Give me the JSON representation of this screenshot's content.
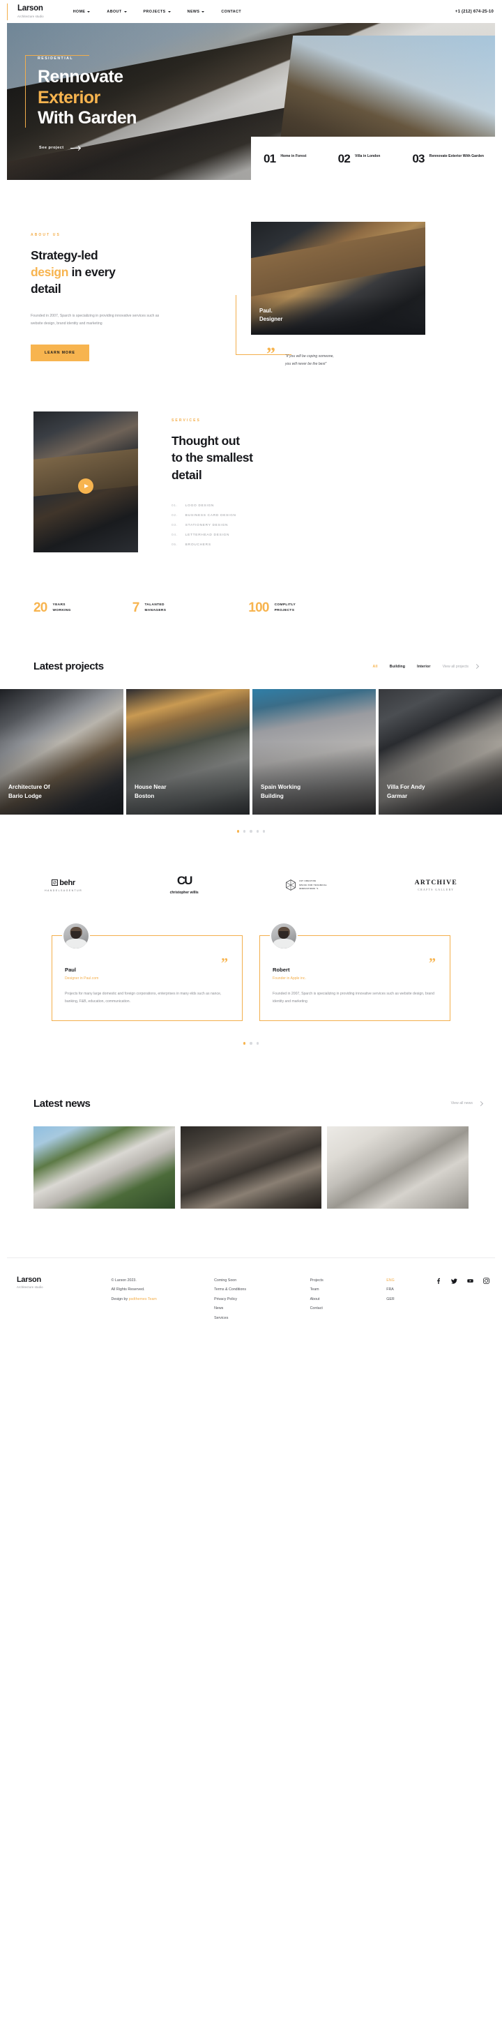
{
  "brand": {
    "name": "Larson",
    "tagline": "Architecture studio"
  },
  "header": {
    "nav": [
      {
        "label": "HOME",
        "has_dropdown": true
      },
      {
        "label": "ABOUT",
        "has_dropdown": true
      },
      {
        "label": "PROJECTS",
        "has_dropdown": true
      },
      {
        "label": "NEWS",
        "has_dropdown": true
      },
      {
        "label": "CONTACT",
        "has_dropdown": false
      }
    ],
    "phone": "+1 (212) 674-25-10"
  },
  "hero": {
    "kicker": "RESIDENTIAL",
    "title_line1": "Rennovate",
    "title_line2": "Exterior",
    "title_line3": "With Garden",
    "cta": "See project",
    "cards": [
      {
        "num": "01",
        "label": "Home in Forest"
      },
      {
        "num": "02",
        "label": "Villa in London"
      },
      {
        "num": "03",
        "label": "Rennovate Exterior With Garden"
      }
    ]
  },
  "about": {
    "kicker": "ABOUT US",
    "title_a": "Strategy-led",
    "title_accent": "design",
    "title_b": " in every",
    "title_c": "detail",
    "body": "Founded in 2007, Sparch is specializing in providing innovative services such as website design, brand identity and marketing",
    "button": "LEARN MORE",
    "image_caption_line1": "Paul.",
    "image_caption_line2": "Designer",
    "quote_line1": "“If you will be coping someone,",
    "quote_line2": "you will never be the best”"
  },
  "services": {
    "kicker": "SERVICES",
    "title_line1": "Thought out",
    "title_line2": "to the smallest",
    "title_line3": "detail",
    "items": [
      {
        "num": "01.",
        "label": "LOGO DESIGN"
      },
      {
        "num": "02.",
        "label": "BUSINESS CARD DESIGN"
      },
      {
        "num": "03.",
        "label": "STATIONERY DESIGN"
      },
      {
        "num": "04.",
        "label": "LETTERHEAD DESIGN"
      },
      {
        "num": "05.",
        "label": "BROUCHERS"
      }
    ]
  },
  "stats": [
    {
      "value": "20",
      "label_line1": "YEARS",
      "label_line2": "WORKING"
    },
    {
      "value": "7",
      "label_line1": "TALANTED",
      "label_line2": "MANAGERS"
    },
    {
      "value": "100",
      "label_line1": "COMPLITLY",
      "label_line2": "PROJECTS"
    }
  ],
  "projects": {
    "title": "Latest projects",
    "filters": [
      {
        "label": "All",
        "active": true
      },
      {
        "label": "Building",
        "active": false
      },
      {
        "label": "Interior",
        "active": false
      }
    ],
    "view_all": "View all projects",
    "cards": [
      {
        "title_line1": "Architecture Of",
        "title_line2": "Bario Lodge"
      },
      {
        "title_line1": "House Near",
        "title_line2": "Boston"
      },
      {
        "title_line1": "Spain Working",
        "title_line2": "Building"
      },
      {
        "title_line1": "Villa For Andy",
        "title_line2": "Garmar"
      }
    ],
    "dots": 5,
    "active_dot": 0
  },
  "partners": [
    {
      "name": "behr",
      "sub": "HANDELSAGENTUR"
    },
    {
      "name": "christopher willis",
      "mark": "CU"
    },
    {
      "name": "1st creative space",
      "lines": [
        "1ST CREATIVE",
        "SPACE FOR TECHNICAL",
        "INNOVATIONS *1"
      ]
    },
    {
      "name": "ARTCHIVE",
      "sub": "CRAFTS GALLERY"
    }
  ],
  "testimonials": {
    "cards": [
      {
        "name": "Paul",
        "role": "Designer in Paul.com",
        "text": "Projects for many large domestic and foreign corporations, enterprises in many elds such as nance, banking, F&B, education, communication."
      },
      {
        "name": "Robert",
        "role": "Founder in Apple inc.",
        "text": "Founded in 2007, Sparch is specializing in providing innovative services such as website design, brand identity and marketing"
      }
    ],
    "dots": 3,
    "active_dot": 0
  },
  "news": {
    "title": "Latest news",
    "view_all": "View all news",
    "cards": [
      {
        "id": 1
      },
      {
        "id": 2
      },
      {
        "id": 3
      }
    ]
  },
  "footer": {
    "copyright_line1": "© Larson 2023.",
    "copyright_line2": "All Rights Reserved.",
    "design_by_prefix": "Design by ",
    "design_by_link": "psdthemes Team",
    "col_links_1": [
      "Coming Soon",
      "Terms & Conditions",
      "Privacy Policy",
      "News",
      "Services"
    ],
    "col_links_2": [
      "Projects",
      "Team",
      "About",
      "Contact"
    ],
    "languages": [
      {
        "label": "ENG",
        "active": true
      },
      {
        "label": "FRA",
        "active": false
      },
      {
        "label": "GER",
        "active": false
      }
    ],
    "socials": [
      "facebook-icon",
      "twitter-icon",
      "youtube-icon",
      "instagram-icon"
    ]
  },
  "colors": {
    "accent": "#f7b44f",
    "text": "#17181c",
    "muted": "#8b8d93"
  }
}
